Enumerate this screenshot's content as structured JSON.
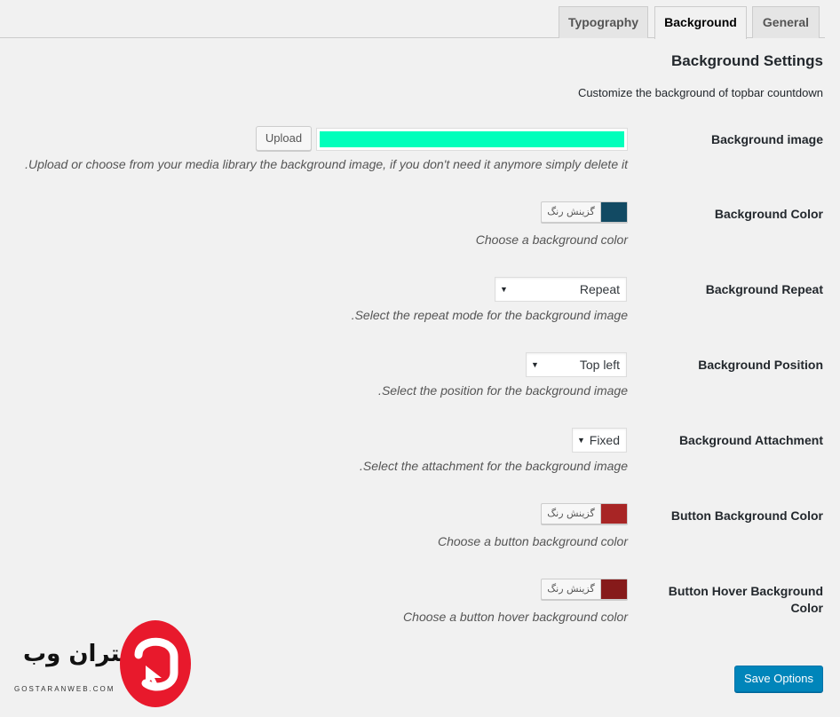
{
  "tabs": [
    {
      "label": "Typography",
      "active": false
    },
    {
      "label": "Background",
      "active": true
    },
    {
      "label": "General",
      "active": false
    }
  ],
  "section": {
    "title": "Background Settings",
    "description": "Customize the background of topbar countdown"
  },
  "background_image": {
    "label": "Background image",
    "upload_label": "Upload",
    "value_color": "#00ffbb",
    "description": "Upload or choose from your media library the background image, if you don't need it anymore simply delete it."
  },
  "background_color": {
    "label": "Background Color",
    "picker_text": "گزینش رنگ",
    "color": "#124a63",
    "description": "Choose a background color"
  },
  "background_repeat": {
    "label": "Background Repeat",
    "value": "Repeat",
    "description": "Select the repeat mode for the background image."
  },
  "background_position": {
    "label": "Background Position",
    "value": "Top left",
    "description": "Select the position for the background image."
  },
  "background_attachment": {
    "label": "Background Attachment",
    "value": "Fixed",
    "description": "Select the attachment for the background image."
  },
  "button_background_color": {
    "label": "Button Background Color",
    "picker_text": "گزینش رنگ",
    "color": "#a82525",
    "description": "Choose a button background color"
  },
  "button_hover_background_color": {
    "label": "Button Hover Background Color",
    "picker_text": "گزینش رنگ",
    "color": "#861a1a",
    "description": "Choose a button hover background color"
  },
  "actions": {
    "save_label": "Save Options"
  },
  "logo": {
    "text": "گستران وب",
    "domain": "GOSTARANWEB.COM",
    "color": "#e8192c"
  }
}
